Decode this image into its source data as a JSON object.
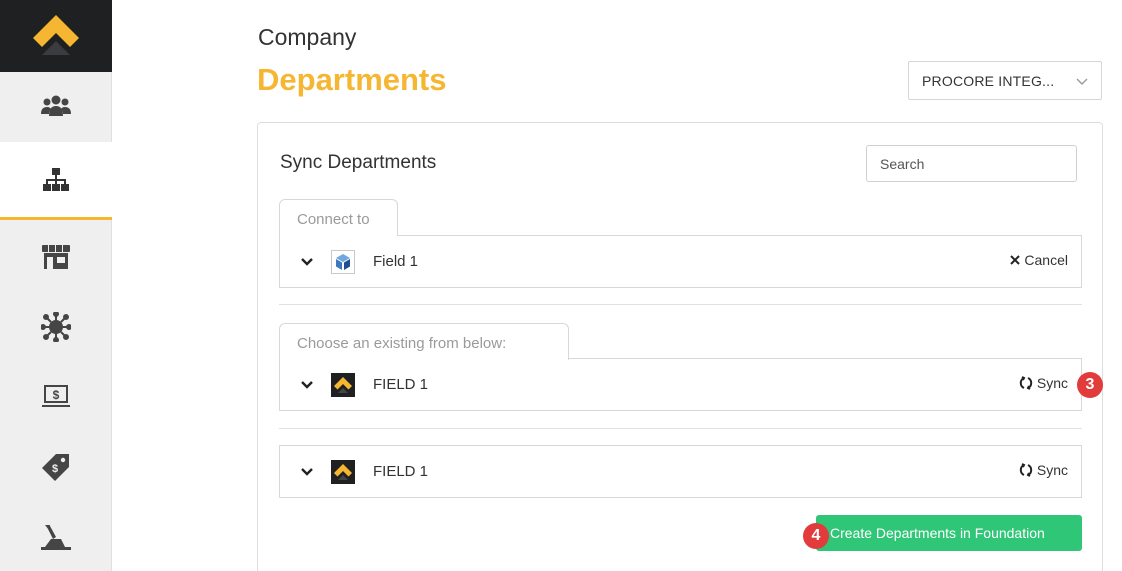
{
  "header": {
    "company": "Company",
    "title": "Departments",
    "integration_select": "PROCORE INTEG..."
  },
  "card": {
    "title": "Sync Departments",
    "search_placeholder": "Search",
    "connect_tab": "Connect to",
    "connect_row": {
      "label": "Field 1",
      "action": "Cancel",
      "icon": "cube-icon"
    },
    "existing_tab": "Choose an existing from below:",
    "existing_rows": [
      {
        "label": "FIELD 1",
        "action": "Sync",
        "icon": "foundation-logo-icon"
      },
      {
        "label": "FIELD 1",
        "action": "Sync",
        "icon": "foundation-logo-icon"
      }
    ],
    "create_button": "Create Departments in Foundation"
  },
  "badges": [
    "3",
    "4"
  ],
  "colors": {
    "accent": "#f5b731",
    "success": "#2fc677",
    "badge": "#e23b3b",
    "sidebar_dark": "#1e2022"
  },
  "sidebar_icons": [
    "users-icon",
    "org-chart-icon",
    "storefront-icon",
    "network-dollar-icon",
    "monitor-dollar-icon",
    "price-tag-icon",
    "excavator-icon"
  ]
}
